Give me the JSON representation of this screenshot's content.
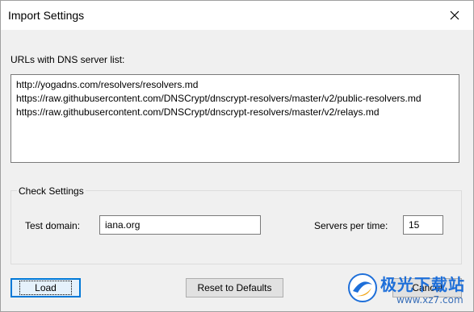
{
  "window": {
    "title": "Import Settings"
  },
  "urls": {
    "label": "URLs with DNS server list:",
    "value": "http://yogadns.com/resolvers/resolvers.md\nhttps://raw.githubusercontent.com/DNSCrypt/dnscrypt-resolvers/master/v2/public-resolvers.md\nhttps://raw.githubusercontent.com/DNSCrypt/dnscrypt-resolvers/master/v2/relays.md"
  },
  "check_settings": {
    "title": "Check Settings",
    "test_domain_label": "Test domain:",
    "test_domain_value": "iana.org",
    "servers_per_time_label": "Servers per time:",
    "servers_per_time_value": "15"
  },
  "buttons": {
    "load": "Load",
    "reset": "Reset to Defaults",
    "cancel": "Cancel"
  },
  "watermark": {
    "text": "极光下载站",
    "url": "www.xz7.com"
  },
  "colors": {
    "focus_border": "#0078d7",
    "watermark_blue": "#1e6fd9"
  }
}
